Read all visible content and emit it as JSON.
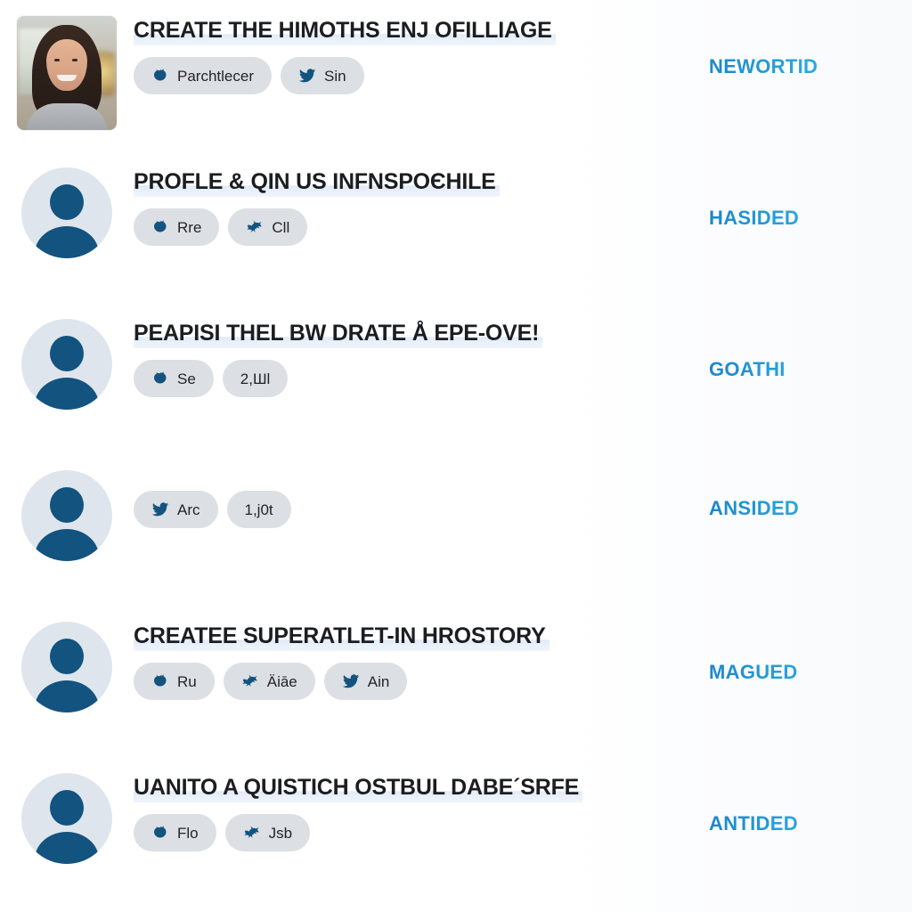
{
  "theme": {
    "background": "#ffffff",
    "title_color": "#1b1d21",
    "title_highlight": "#dfeaf7",
    "chip_background": "#dcdfe3",
    "chip_text": "#22252a",
    "icon_color": "#12537f",
    "status_color_start": "#1b86c9",
    "status_color_end": "#36bdea",
    "avatar_ring": "#dfe5ec",
    "avatar_figure": "#12537f"
  },
  "feed": {
    "items": [
      {
        "avatar": "photo-woman-smiling",
        "avatar_type": "photo",
        "title": "CREATE THE HIMOTHS ENJ OFILLIAGE",
        "status": "NEWORTID",
        "chips": [
          {
            "icon": "bird-blob-icon",
            "label": "Parchtlecer"
          },
          {
            "icon": "twitter-bird-icon",
            "label": "Sin"
          }
        ]
      },
      {
        "avatar": "person-placeholder",
        "avatar_type": "placeholder",
        "title": "PROFLE & QIN US INFNSPOЄHILE",
        "status": "HASIDED",
        "chips": [
          {
            "icon": "bird-blob-icon",
            "label": "Rre"
          },
          {
            "icon": "flying-bird-icon",
            "label": "Cll"
          }
        ]
      },
      {
        "avatar": "person-placeholder",
        "avatar_type": "placeholder",
        "title": "PEAPISI THEL BW DRATE Å EPE-OVE!",
        "status": "GOATHI",
        "chips": [
          {
            "icon": "bird-blob-icon",
            "label": "Se"
          },
          {
            "icon": "none",
            "label": "2,Шl"
          }
        ]
      },
      {
        "avatar": "person-placeholder",
        "avatar_type": "placeholder",
        "title": "",
        "status": "ANSIDED",
        "chips": [
          {
            "icon": "twitter-bird-icon",
            "label": "Arc"
          },
          {
            "icon": "none",
            "label": "1,j0t"
          }
        ]
      },
      {
        "avatar": "person-placeholder",
        "avatar_type": "placeholder",
        "title": "CREATEE SUPERATLET-IN HROSTORY",
        "status": "MAGUED",
        "chips": [
          {
            "icon": "bird-blob-icon",
            "label": "Ru"
          },
          {
            "icon": "flying-bird-icon",
            "label": "Äiāe"
          },
          {
            "icon": "twitter-bird-icon",
            "label": "Ain"
          }
        ]
      },
      {
        "avatar": "person-placeholder",
        "avatar_type": "placeholder",
        "title": "UANITO A QUISTICH OSTBUL DABE´SRFE",
        "status": "ANTIDED",
        "chips": [
          {
            "icon": "bird-blob-icon",
            "label": "Flo"
          },
          {
            "icon": "flying-bird-icon",
            "label": "Jsb"
          }
        ]
      }
    ]
  }
}
